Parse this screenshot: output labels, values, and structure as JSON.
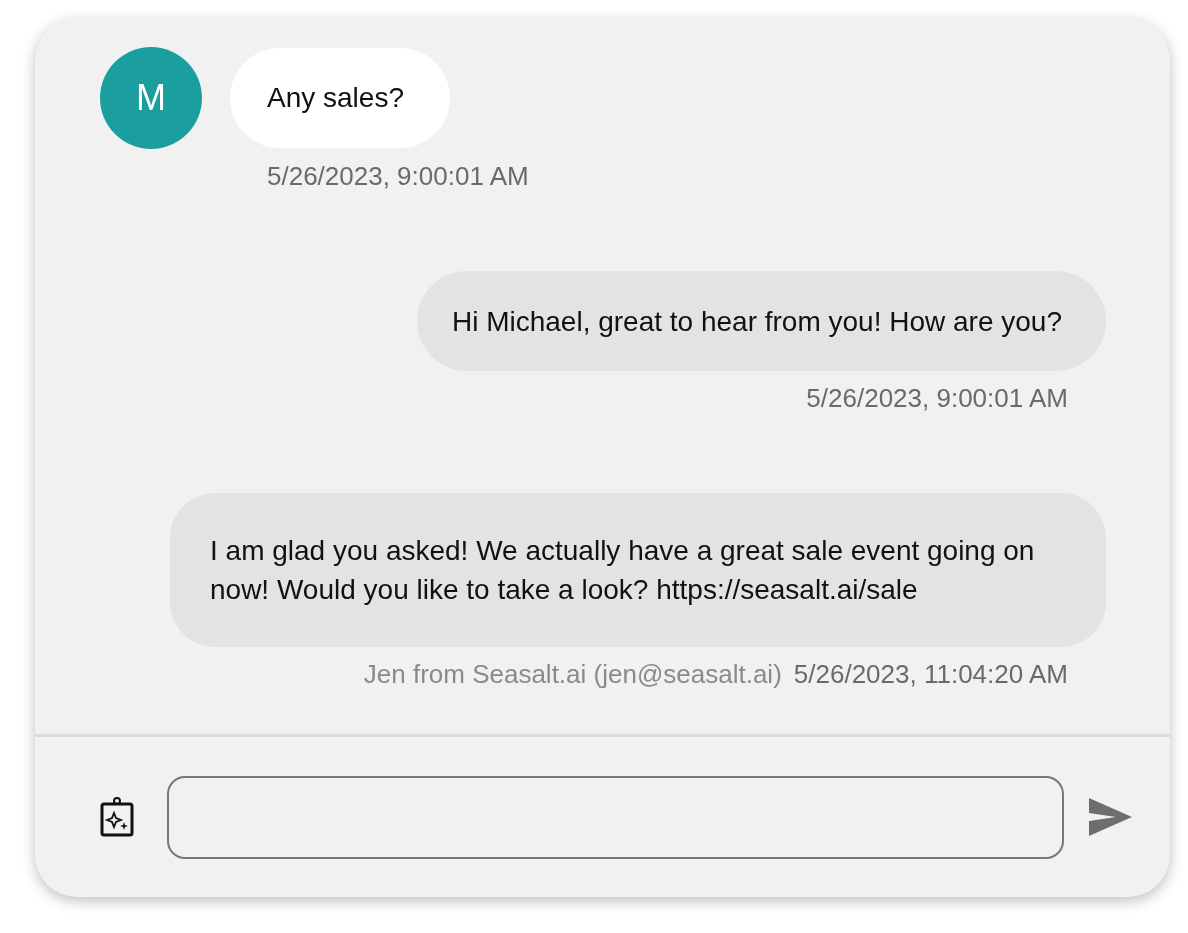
{
  "messages": [
    {
      "kind": "incoming",
      "avatar": "M",
      "text": "Any sales?",
      "timestamp": "5/26/2023, 9:00:01 AM"
    },
    {
      "kind": "outgoing",
      "text": "Hi Michael, great to hear from you! How are you?",
      "timestamp": "5/26/2023, 9:00:01 AM"
    },
    {
      "kind": "outgoing",
      "text": "I am glad you asked! We actually have a great sale event going on now! Would you like to take a look? https://seasalt.ai/sale",
      "sender": "Jen from Seasalt.ai (jen@seasalt.ai)",
      "timestamp": "5/26/2023, 11:04:20 AM"
    }
  ]
}
